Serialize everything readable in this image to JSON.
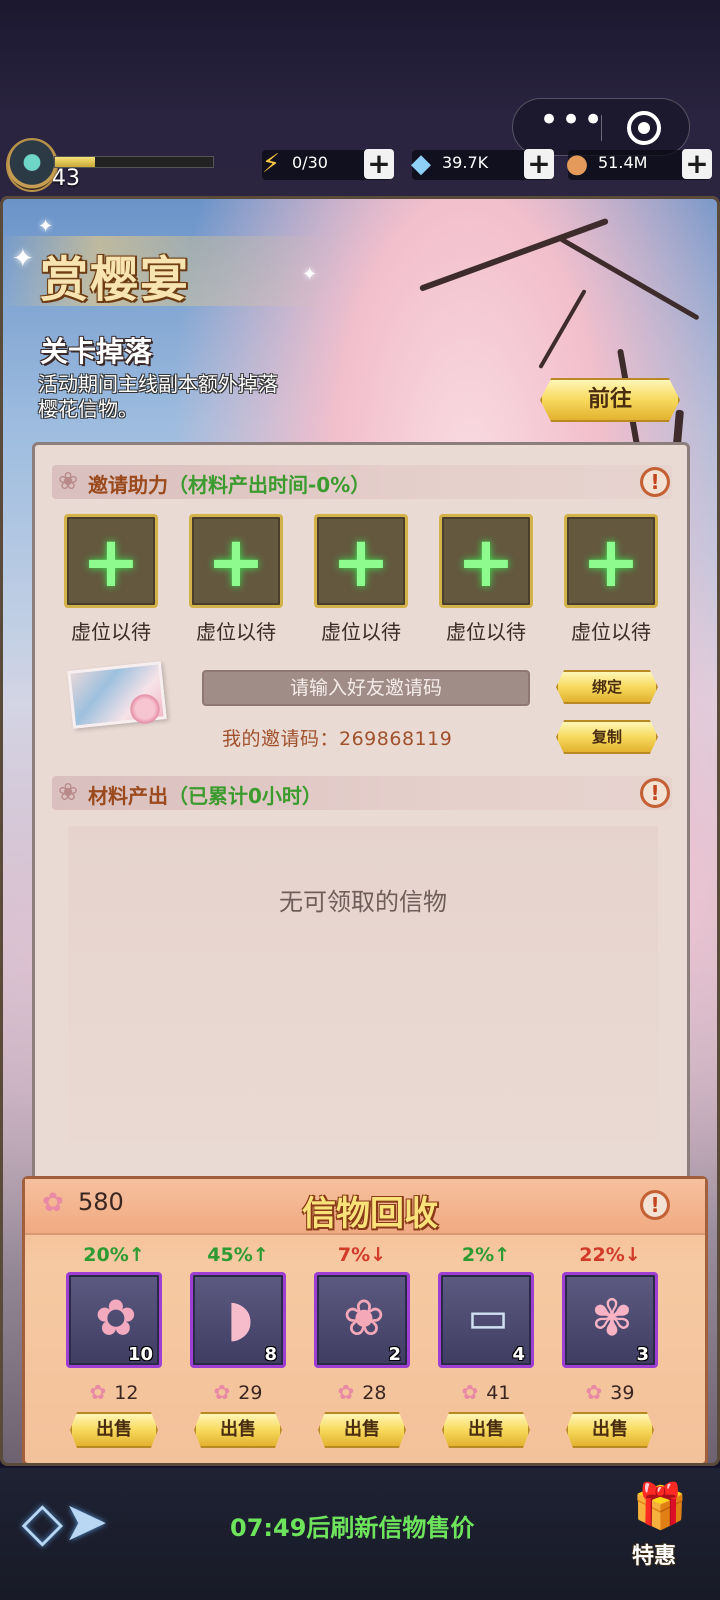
{
  "capsule": {
    "more_icon": "more-dots-icon",
    "close_icon": "target-close-icon"
  },
  "player": {
    "level": "43",
    "xp_fraction": 0.25
  },
  "resources": [
    {
      "name": "energy",
      "icon": "lightning-icon",
      "value": "0/30"
    },
    {
      "name": "diamond",
      "icon": "diamond-icon",
      "value": "39.7K"
    },
    {
      "name": "coin",
      "icon": "coin-icon",
      "value": "51.4M"
    }
  ],
  "event": {
    "title": "赏樱宴",
    "subtitle": "关卡掉落",
    "description": "活动期间主线副本额外掉落樱花信物。",
    "goto_label": "前往"
  },
  "invite": {
    "header_label": "邀请助力",
    "header_note": "（材料产出时间-0%）",
    "slots": [
      {
        "label": "虚位以待"
      },
      {
        "label": "虚位以待"
      },
      {
        "label": "虚位以待"
      },
      {
        "label": "虚位以待"
      },
      {
        "label": "虚位以待"
      }
    ],
    "input_placeholder": "请输入好友邀请码",
    "bind_label": "绑定",
    "copy_label": "复制",
    "my_code": "我的邀请码：269868119"
  },
  "materials": {
    "header_label": "材料产出",
    "header_note": "（已累计0小时）",
    "empty_text": "无可领取的信物"
  },
  "recycle": {
    "title": "信物回收",
    "petal_count": "580",
    "items": [
      {
        "change": "20%↑",
        "trend": "up",
        "art": "sakura-charm",
        "qty": "10",
        "price": "12",
        "sell_label": "出售"
      },
      {
        "change": "45%↑",
        "trend": "up",
        "art": "sakura-fan",
        "qty": "8",
        "price": "29",
        "sell_label": "出售"
      },
      {
        "change": "7%↓",
        "trend": "down",
        "art": "sakura-hairpin",
        "qty": "2",
        "price": "28",
        "sell_label": "出售"
      },
      {
        "change": "2%↑",
        "trend": "up",
        "art": "sakura-postcard",
        "qty": "4",
        "price": "41",
        "sell_label": "出售"
      },
      {
        "change": "22%↓",
        "trend": "down",
        "art": "sakura-bouquet",
        "qty": "3",
        "price": "39",
        "sell_label": "出售"
      }
    ]
  },
  "footer": {
    "refresh_text": "07:49后刷新信物售价",
    "deal_label": "特惠"
  },
  "colors": {
    "accent_gold": "#f7d95c",
    "trend_up": "#2e9b32",
    "trend_down": "#d23a2a",
    "item_border": "#9c3fd2"
  }
}
